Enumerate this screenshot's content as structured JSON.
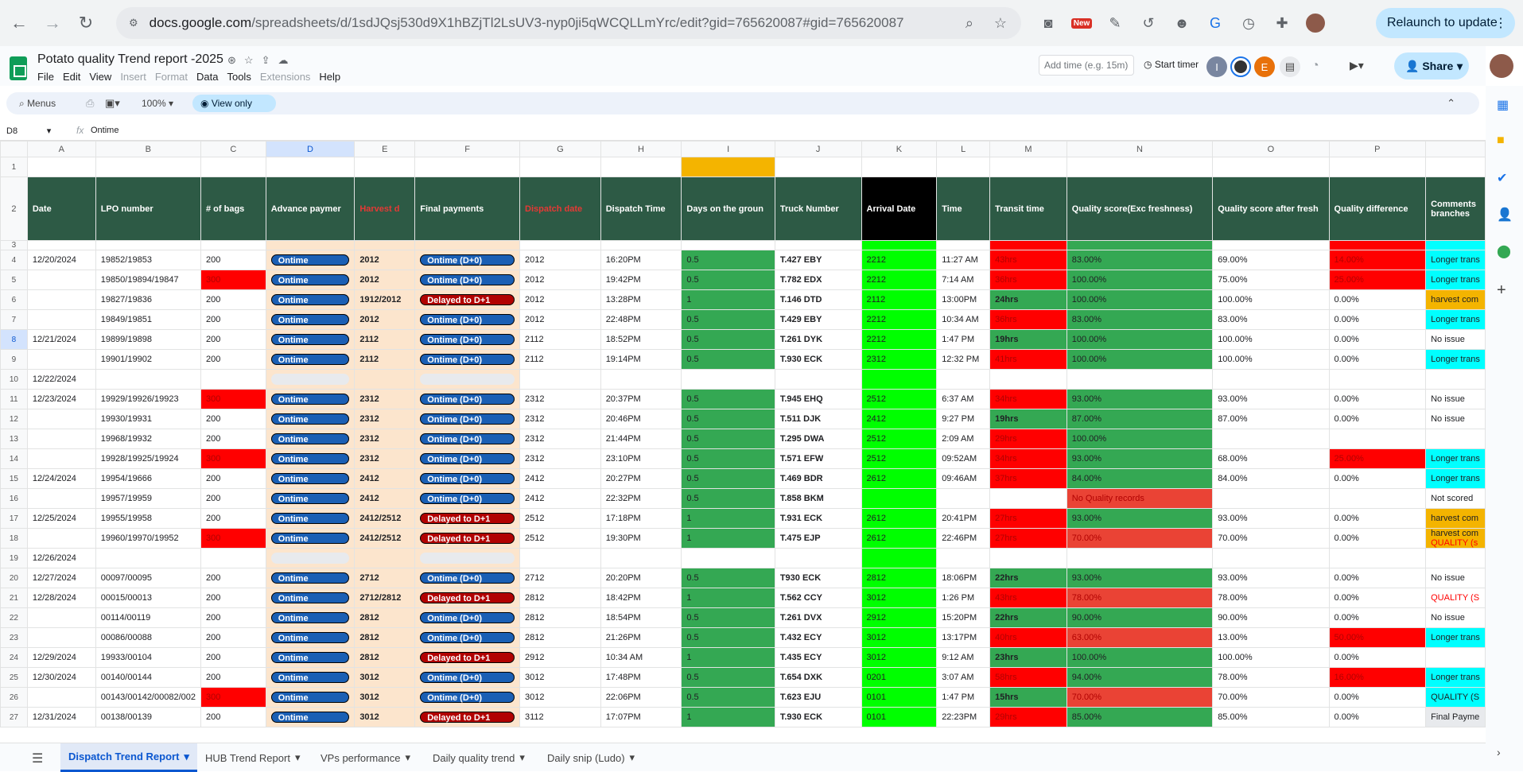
{
  "browser": {
    "url_host": "docs.google.com",
    "url_path": "/spreadsheets/d/1sdJQsj530d9X1hBZjTl2LsUV3-nyp0ji5qWCQLLmYrc/edit?gid=765620087#gid=765620087",
    "relaunch": "Relaunch to update",
    "new_badge": "New"
  },
  "app": {
    "title": "Potato quality Trend report -2025",
    "menus": [
      "File",
      "Edit",
      "View",
      "Insert",
      "Format",
      "Data",
      "Tools",
      "Extensions",
      "Help"
    ],
    "add_time_placeholder": "Add time (e.g. 15m)",
    "start_timer": "Start timer",
    "share": "Share",
    "avatars": [
      "I",
      "",
      "E"
    ]
  },
  "toolbar": {
    "menus": "Menus",
    "zoom": "100%",
    "view_only": "View only"
  },
  "formula": {
    "cell": "D8",
    "value": "Ontime"
  },
  "columns": [
    "A",
    "B",
    "C",
    "D",
    "E",
    "F",
    "G",
    "H",
    "I",
    "J",
    "K",
    "L",
    "M",
    "N",
    "O",
    "P"
  ],
  "headers": [
    "Date",
    "LPO number",
    "# of bags",
    "Advance paymer",
    "Harvest d",
    "Final payments",
    "Dispatch date",
    "Dispatch Time",
    "Days on the groun",
    "Truck Number",
    "Arrival Date",
    "Time",
    "Transit time",
    "Quality score(Exc freshness)",
    "Quality score after fresh",
    "Quality difference",
    "Comments branches"
  ],
  "rows": [
    {
      "n": "4",
      "a": "12/20/2024",
      "b": "19852/19853",
      "c": "200",
      "d": "Ontime",
      "e": "2012",
      "f": "Ontime (D+0)",
      "g": "2012",
      "h": "16:20PM",
      "i": "0.5",
      "j": "T.427 EBY",
      "k": "2212",
      "l": "11:27 AM",
      "m": "43hrs",
      "n2": "83.00%",
      "o": "69.00%",
      "p": "14.00%",
      "q": "Longer trans"
    },
    {
      "n": "5",
      "a": "",
      "b": "19850/19894/19847",
      "c": "300",
      "d": "Ontime",
      "e": "2012",
      "f": "Ontime (D+0)",
      "g": "2012",
      "h": "19:42PM",
      "i": "0.5",
      "j": "T.782 EDX",
      "k": "2212",
      "l": "7:14 AM",
      "m": "36hrs",
      "n2": "100.00%",
      "o": "75.00%",
      "p": "25.00%",
      "q": "Longer trans"
    },
    {
      "n": "6",
      "a": "",
      "b": "19827/19836",
      "c": "200",
      "d": "Ontime",
      "e": "1912/2012",
      "f": "Delayed to D+1",
      "g": "2012",
      "h": "13:28PM",
      "i": "1",
      "j": "T.146 DTD",
      "k": "2112",
      "l": "13:00PM",
      "m": "24hrs",
      "n2": "100.00%",
      "o": "100.00%",
      "p": "0.00%",
      "q": "harvest com"
    },
    {
      "n": "7",
      "a": "",
      "b": "19849/19851",
      "c": "200",
      "d": "Ontime",
      "e": "2012",
      "f": "Ontime (D+0)",
      "g": "2012",
      "h": "22:48PM",
      "i": "0.5",
      "j": "T.429 EBY",
      "k": "2212",
      "l": "10:34 AM",
      "m": "36hrs",
      "n2": "83.00%",
      "o": "83.00%",
      "p": "0.00%",
      "q": "Longer trans"
    },
    {
      "n": "8",
      "a": "12/21/2024",
      "b": "19899/19898",
      "c": "200",
      "d": "Ontime",
      "e": "2112",
      "f": "Ontime (D+0)",
      "g": "2112",
      "h": "18:52PM",
      "i": "0.5",
      "j": "T.261 DYK",
      "k": "2212",
      "l": "1:47 PM",
      "m": "19hrs",
      "n2": "100.00%",
      "o": "100.00%",
      "p": "0.00%",
      "q": "No issue"
    },
    {
      "n": "9",
      "a": "",
      "b": "19901/19902",
      "c": "200",
      "d": "Ontime",
      "e": "2112",
      "f": "Ontime (D+0)",
      "g": "2112",
      "h": "19:14PM",
      "i": "0.5",
      "j": "T.930 ECK",
      "k": "2312",
      "l": "12:32 PM",
      "m": "41hrs",
      "n2": "100.00%",
      "o": "100.00%",
      "p": "0.00%",
      "q": "Longer trans"
    },
    {
      "n": "10",
      "a": "12/22/2024",
      "b": "",
      "c": "",
      "d": "",
      "e": "",
      "f": "",
      "g": "",
      "h": "",
      "i": "",
      "j": "",
      "k": "",
      "l": "",
      "m": "",
      "n2": "",
      "o": "",
      "p": "",
      "q": ""
    },
    {
      "n": "11",
      "a": "12/23/2024",
      "b": "19929/19926/19923",
      "c": "300",
      "d": "Ontime",
      "e": "2312",
      "f": "Ontime (D+0)",
      "g": "2312",
      "h": "20:37PM",
      "i": "0.5",
      "j": "T.945 EHQ",
      "k": "2512",
      "l": "6:37 AM",
      "m": "34hrs",
      "n2": "93.00%",
      "o": "93.00%",
      "p": "0.00%",
      "q": "No issue"
    },
    {
      "n": "12",
      "a": "",
      "b": "19930/19931",
      "c": "200",
      "d": "Ontime",
      "e": "2312",
      "f": "Ontime (D+0)",
      "g": "2312",
      "h": "20:46PM",
      "i": "0.5",
      "j": "T.511 DJK",
      "k": "2412",
      "l": "9:27 PM",
      "m": "19hrs",
      "n2": "87.00%",
      "o": "87.00%",
      "p": "0.00%",
      "q": "No issue"
    },
    {
      "n": "13",
      "a": "",
      "b": "19968/19932",
      "c": "200",
      "d": "Ontime",
      "e": "2312",
      "f": "Ontime (D+0)",
      "g": "2312",
      "h": "21:44PM",
      "i": "0.5",
      "j": "T.295 DWA",
      "k": "2512",
      "l": "2:09 AM",
      "m": "29hrs",
      "n2": "100.00%",
      "o": "",
      "p": "",
      "q": ""
    },
    {
      "n": "14",
      "a": "",
      "b": "19928/19925/19924",
      "c": "300",
      "d": "Ontime",
      "e": "2312",
      "f": "Ontime (D+0)",
      "g": "2312",
      "h": "23:10PM",
      "i": "0.5",
      "j": "T.571 EFW",
      "k": "2512",
      "l": "09:52AM",
      "m": "34hrs",
      "n2": "93.00%",
      "o": "68.00%",
      "p": "25.00%",
      "q": "Longer trans"
    },
    {
      "n": "15",
      "a": "12/24/2024",
      "b": "19954/19666",
      "c": "200",
      "d": "Ontime",
      "e": "2412",
      "f": "Ontime (D+0)",
      "g": "2412",
      "h": "20:27PM",
      "i": "0.5",
      "j": "T.469 BDR",
      "k": "2612",
      "l": "09:46AM",
      "m": "37hrs",
      "n2": "84.00%",
      "o": "84.00%",
      "p": "0.00%",
      "q": "Longer trans"
    },
    {
      "n": "16",
      "a": "",
      "b": "19957/19959",
      "c": "200",
      "d": "Ontime",
      "e": "2412",
      "f": "Ontime (D+0)",
      "g": "2412",
      "h": "22:32PM",
      "i": "0.5",
      "j": "T.858 BKM",
      "k": "",
      "l": "",
      "m": "",
      "n2": "No Quality records",
      "o": "",
      "p": "",
      "q": "Not scored"
    },
    {
      "n": "17",
      "a": "12/25/2024",
      "b": "19955/19958",
      "c": "200",
      "d": "Ontime",
      "e": "2412/2512",
      "f": "Delayed to D+1",
      "g": "2512",
      "h": "17:18PM",
      "i": "1",
      "j": "T.931 ECK",
      "k": "2612",
      "l": "20:41PM",
      "m": "27hrs",
      "n2": "93.00%",
      "o": "93.00%",
      "p": "0.00%",
      "q": "harvest com"
    },
    {
      "n": "18",
      "a": "",
      "b": "19960/19970/19952",
      "c": "300",
      "d": "Ontime",
      "e": "2412/2512",
      "f": "Delayed to D+1",
      "g": "2512",
      "h": "19:30PM",
      "i": "1",
      "j": "T.475 EJP",
      "k": "2612",
      "l": "22:46PM",
      "m": "27hrs",
      "n2": "70.00%",
      "o": "70.00%",
      "p": "0.00%",
      "q": "harvest com",
      "q2": "QUALITY (s"
    },
    {
      "n": "19",
      "a": "12/26/2024",
      "b": "",
      "c": "",
      "d": "",
      "e": "",
      "f": "",
      "g": "",
      "h": "",
      "i": "",
      "j": "",
      "k": "",
      "l": "",
      "m": "",
      "n2": "",
      "o": "",
      "p": "",
      "q": ""
    },
    {
      "n": "20",
      "a": "12/27/2024",
      "b": "00097/00095",
      "c": "200",
      "d": "Ontime",
      "e": "2712",
      "f": "Ontime (D+0)",
      "g": "2712",
      "h": "20:20PM",
      "i": "0.5",
      "j": "T930 ECK",
      "k": "2812",
      "l": "18:06PM",
      "m": "22hrs",
      "n2": "93.00%",
      "o": "93.00%",
      "p": "0.00%",
      "q": "No issue"
    },
    {
      "n": "21",
      "a": "12/28/2024",
      "b": "00015/00013",
      "c": "200",
      "d": "Ontime",
      "e": "2712/2812",
      "f": "Delayed to D+1",
      "g": "2812",
      "h": "18:42PM",
      "i": "1",
      "j": "T.562 CCY",
      "k": "3012",
      "l": "1:26 PM",
      "m": "43hrs",
      "n2": "78.00%",
      "o": "78.00%",
      "p": "0.00%",
      "q": "QUALITY (S"
    },
    {
      "n": "22",
      "a": "",
      "b": "00114/00119",
      "c": "200",
      "d": "Ontime",
      "e": "2812",
      "f": "Ontime (D+0)",
      "g": "2812",
      "h": "18:54PM",
      "i": "0.5",
      "j": "T.261 DVX",
      "k": "2912",
      "l": "15:20PM",
      "m": "22hrs",
      "n2": "90.00%",
      "o": "90.00%",
      "p": "0.00%",
      "q": "No issue"
    },
    {
      "n": "23",
      "a": "",
      "b": "00086/00088",
      "c": "200",
      "d": "Ontime",
      "e": "2812",
      "f": "Ontime (D+0)",
      "g": "2812",
      "h": "21:26PM",
      "i": "0.5",
      "j": "T.432 ECY",
      "k": "3012",
      "l": "13:17PM",
      "m": "40hrs",
      "n2": "63.00%",
      "o": "13.00%",
      "p": "50.00%",
      "q": "Longer trans"
    },
    {
      "n": "24",
      "a": "12/29/2024",
      "b": "19933/00104",
      "c": "200",
      "d": "Ontime",
      "e": "2812",
      "f": "Delayed to D+1",
      "g": "2912",
      "h": "10:34 AM",
      "i": "1",
      "j": "T.435 ECY",
      "k": "3012",
      "l": "9:12 AM",
      "m": "23hrs",
      "n2": "100.00%",
      "o": "100.00%",
      "p": "0.00%",
      "q": ""
    },
    {
      "n": "25",
      "a": "12/30/2024",
      "b": "00140/00144",
      "c": "200",
      "d": "Ontime",
      "e": "3012",
      "f": "Ontime (D+0)",
      "g": "3012",
      "h": "17:48PM",
      "i": "0.5",
      "j": "T.654 DXK",
      "k": "0201",
      "l": "3:07 AM",
      "m": "58hrs",
      "n2": "94.00%",
      "o": "78.00%",
      "p": "16.00%",
      "q": "Longer trans"
    },
    {
      "n": "26",
      "a": "",
      "b": "00143/00142/00082/002",
      "c": "300",
      "d": "Ontime",
      "e": "3012",
      "f": "Ontime (D+0)",
      "g": "3012",
      "h": "22:06PM",
      "i": "0.5",
      "j": "T.623 EJU",
      "k": "0101",
      "l": "1:47 PM",
      "m": "15hrs",
      "n2": "70.00%",
      "o": "70.00%",
      "p": "0.00%",
      "q": "QUALITY (S"
    },
    {
      "n": "27",
      "a": "12/31/2024",
      "b": "00138/00139",
      "c": "200",
      "d": "Ontime",
      "e": "3012",
      "f": "Delayed to D+1",
      "g": "3112",
      "h": "17:07PM",
      "i": "1",
      "j": "T.930 ECK",
      "k": "0101",
      "l": "22:23PM",
      "m": "29hrs",
      "n2": "85.00%",
      "o": "85.00%",
      "p": "0.00%",
      "q": "Final Payme"
    }
  ],
  "tabs": [
    "Dispatch Trend Report",
    "HUB Trend Report",
    "VPs performance",
    "Daily quality trend",
    "Daily snip (Ludo)"
  ]
}
